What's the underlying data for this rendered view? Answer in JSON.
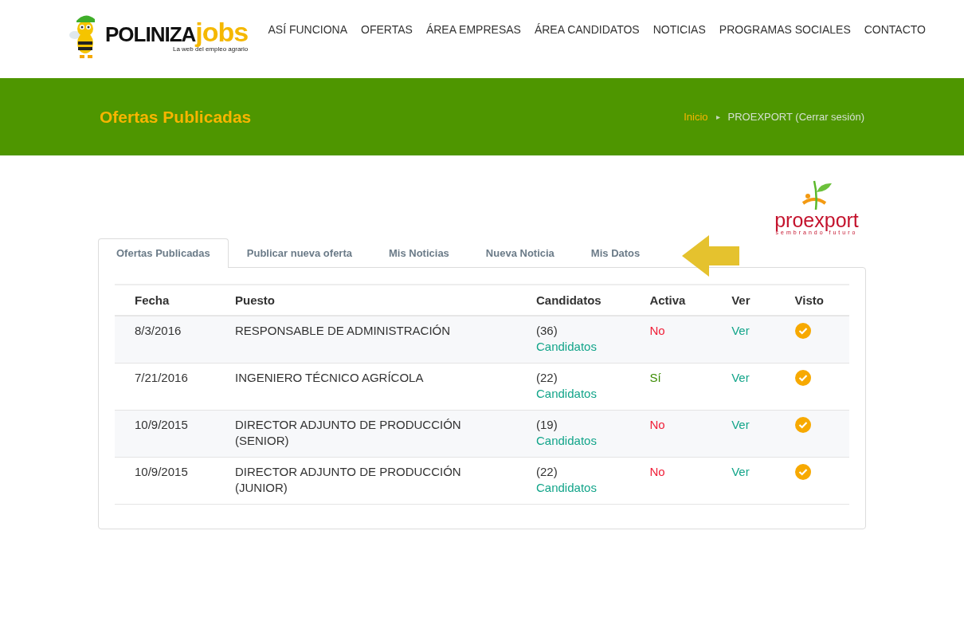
{
  "logo": {
    "word1": "POLINIZA",
    "word2": "jobs",
    "tagline": "La web del empleo agrario"
  },
  "nav": [
    "ASÍ FUNCIONA",
    "OFERTAS",
    "ÁREA EMPRESAS",
    "ÁREA CANDIDATOS",
    "NOTICIAS",
    "PROGRAMAS SOCIALES",
    "CONTACTO"
  ],
  "banner": {
    "title": "Ofertas Publicadas",
    "breadcrumb_home": "Inicio",
    "breadcrumb_separator": "▸",
    "breadcrumb_current": "PROEXPORT (Cerrar sesión)"
  },
  "company_logo": {
    "name": "proexport",
    "tagline": "sembrando futuro"
  },
  "tabs": [
    {
      "label": "Ofertas Publicadas",
      "selected": true
    },
    {
      "label": "Publicar nueva oferta",
      "selected": false
    },
    {
      "label": "Mis Noticias",
      "selected": false
    },
    {
      "label": "Nueva Noticia",
      "selected": false
    },
    {
      "label": "Mis Datos",
      "selected": false
    }
  ],
  "table": {
    "columns": [
      "Fecha",
      "Puesto",
      "Candidatos",
      "Activa",
      "Ver",
      "Visto"
    ],
    "rows": [
      {
        "fecha": "8/3/2016",
        "puesto": "RESPONSABLE DE ADMINISTRACIÓN",
        "count": "(36)",
        "candidatos": "Candidatos",
        "activa": "No",
        "active": false,
        "ver": "Ver",
        "visto": true
      },
      {
        "fecha": "7/21/2016",
        "puesto": "INGENIERO TÉCNICO AGRÍCOLA",
        "count": "(22)",
        "candidatos": "Candidatos",
        "activa": "Sí",
        "active": true,
        "ver": "Ver",
        "visto": true
      },
      {
        "fecha": "10/9/2015",
        "puesto": "DIRECTOR ADJUNTO DE PRODUCCIÓN (SENIOR)",
        "count": "(19)",
        "candidatos": "Candidatos",
        "activa": "No",
        "active": false,
        "ver": "Ver",
        "visto": true
      },
      {
        "fecha": "10/9/2015",
        "puesto": "DIRECTOR ADJUNTO DE PRODUCCIÓN (JUNIOR)",
        "count": "(22)",
        "candidatos": "Candidatos",
        "activa": "No",
        "active": false,
        "ver": "Ver",
        "visto": true
      }
    ]
  }
}
